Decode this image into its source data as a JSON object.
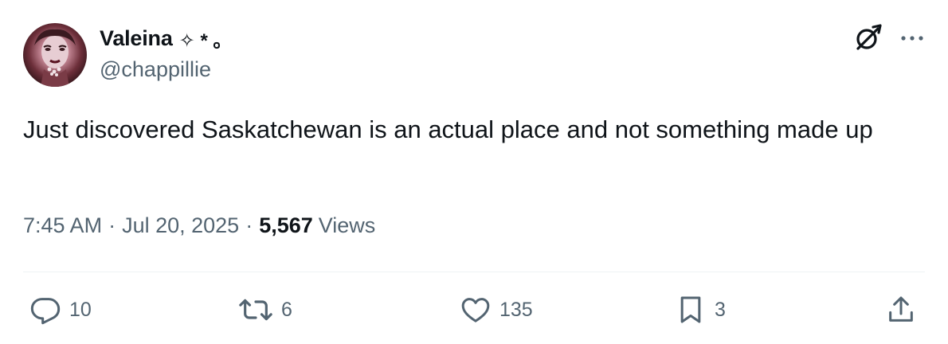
{
  "author": {
    "display_name": "Valeina",
    "name_decoration": "✧ * ｡",
    "handle": "@chappillie"
  },
  "top_icons": {
    "grok": "grok-icon",
    "more": "more-icon"
  },
  "tweet": {
    "text": "Just discovered Saskatchewan is an actual place and not something made up"
  },
  "meta": {
    "time": "7:45 AM",
    "separator": "·",
    "date": "Jul 20, 2025",
    "views_count": "5,567",
    "views_label": "Views"
  },
  "actions": {
    "reply": {
      "icon": "reply-icon",
      "count": "10"
    },
    "retweet": {
      "icon": "retweet-icon",
      "count": "6"
    },
    "like": {
      "icon": "heart-icon",
      "count": "135"
    },
    "bookmark": {
      "icon": "bookmark-icon",
      "count": "3"
    },
    "share": {
      "icon": "share-icon"
    }
  },
  "colors": {
    "primary_text": "#0f1419",
    "secondary_text": "#536471",
    "divider": "#eff3f4"
  }
}
